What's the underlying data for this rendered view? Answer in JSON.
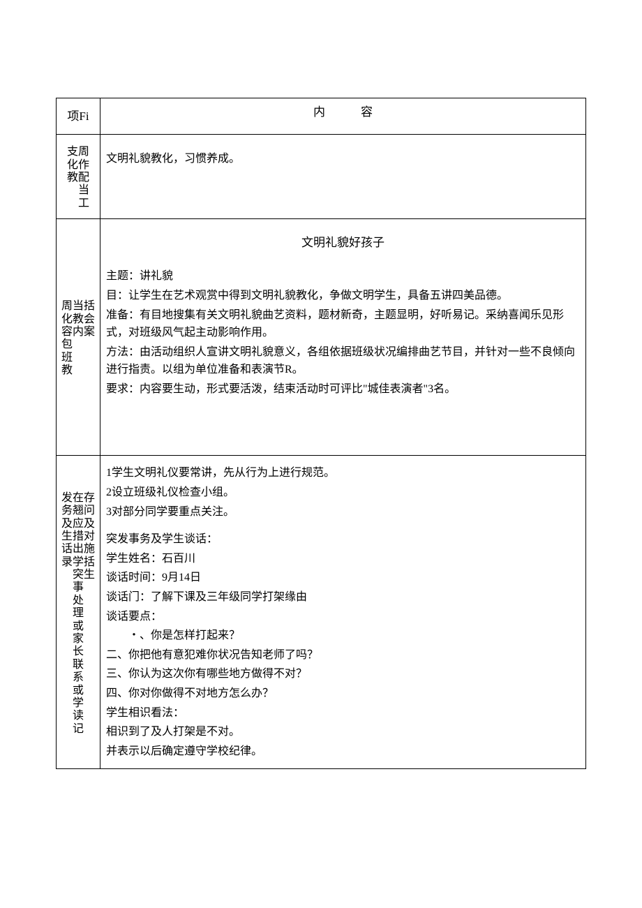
{
  "header": {
    "col1": "项Fi",
    "col2": "内容"
  },
  "row1": {
    "label_cols": [
      "周作配当工",
      "支化教"
    ],
    "content": "文明礼貌教化，习惯养成。"
  },
  "row2": {
    "label_cols": [
      "周化容包班教",
      "当教内",
      "括会案"
    ],
    "title": "文明礼貌好孩子",
    "lines": [
      "主题：讲礼貌",
      "目：让学生在艺术观赏中得到文明礼貌教化，争做文明学生，具备五讲四美品德。",
      "准备：有目地搜集有关文明礼貌曲艺资料，题材新奇，主题显明，好听易记。采纳喜闻乐见形式，对班级风气起主动影响作用。",
      "方法：由活动组织人宣讲文明礼貌意义，各组依据班级状况编排曲艺节目，并针对一些不良倾向进行指责。以组为单位准备和表演节R。",
      "要求：内容要生动，形式要活泼，结束活动时可评比\"城佳表演者\"3名。"
    ]
  },
  "row3": {
    "label_cols": [
      "在翘应措出学突事处理或家长联系或学读记",
      "发务及生话录",
      "存问及对施括生"
    ],
    "block1": [
      "1学生文明礼仪要常讲，先从行为上进行规范。",
      "2设立班级礼仪检查小组。",
      "3对部分同学要重点关注。"
    ],
    "block2": [
      "突发事务及学生谈话：",
      "学生姓名：石百川",
      "谈话时间：9月14日",
      "谈话门：了解下课及三年级同学打架缘由",
      "谈话要点："
    ],
    "points": [
      "・、你是怎样打起来？",
      "二、你把他有意犯难你状况告知老师了吗？",
      "三、你认为这次你有哪些地方做得不对？",
      "四、你对你做得不对地方怎么办？"
    ],
    "block3": [
      "学生相识看法：",
      "相识到了及人打架是不对。",
      "并表示以后确定遵守学校纪律。"
    ]
  }
}
